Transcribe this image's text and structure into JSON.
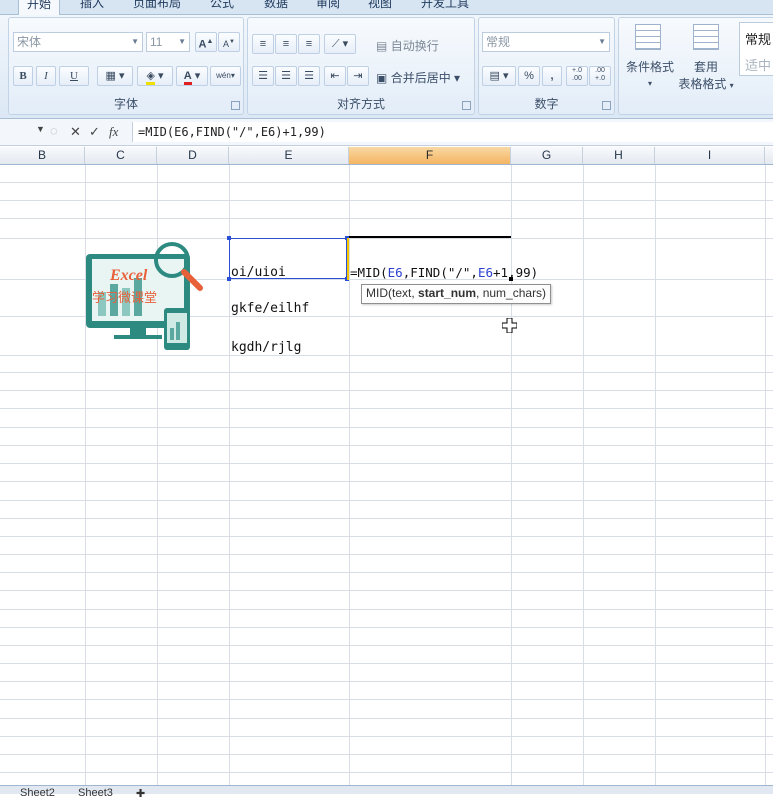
{
  "ribbon": {
    "tabs": [
      "开始",
      "插入",
      "页面布局",
      "公式",
      "数据",
      "审阅",
      "视图",
      "开发工具"
    ],
    "font_group": {
      "label": "字体",
      "font_name": "宋体",
      "font_size": "11",
      "grow_label": "A",
      "shrink_label": "A",
      "bold": "B",
      "italic": "I",
      "underline": "U",
      "font_color_label": "A",
      "phonetic_label": "wén"
    },
    "align_group": {
      "label": "对齐方式",
      "wrap_text": "自动换行",
      "merge_center": "合并后居中"
    },
    "number_group": {
      "label": "数字",
      "format": "常规",
      "percent": "%",
      "comma": ",",
      "inc_decimal": "+.0 .00",
      "dec_decimal": ".00 +.0"
    },
    "styles_group": {
      "conditional_format": "条件格式",
      "table_format_line1": "套用",
      "table_format_line2": "表格格式",
      "cell_style_partial_top": "常规",
      "cell_style_partial_bottom": "适中"
    }
  },
  "formula_bar": {
    "fx": "fx",
    "formula": "=MID(E6,FIND(\"/\",E6)+1,99)"
  },
  "columns": [
    {
      "name": "B",
      "selected": false
    },
    {
      "name": "C",
      "selected": false
    },
    {
      "name": "D",
      "selected": false
    },
    {
      "name": "E",
      "selected": false
    },
    {
      "name": "F",
      "selected": true
    },
    {
      "name": "G",
      "selected": false
    },
    {
      "name": "H",
      "selected": false
    },
    {
      "name": "I",
      "selected": false
    }
  ],
  "cells": {
    "e6": "oi/uioi",
    "e7": "gkfe/eilhf",
    "e8": "kgdh/rjlg"
  },
  "editing": {
    "prefix": "=MID(",
    "ref1": "E6",
    "mid": ",FIND(\"/\",",
    "ref2": "E6",
    "suffix": "+1,99)"
  },
  "tooltip": {
    "func": "MID(text, ",
    "bold_arg": "start_num",
    "rest": ", num_chars)"
  },
  "logo": {
    "word": "Excel",
    "subtitle": "学习微课堂"
  },
  "sheets": [
    "Sheet2",
    "Sheet3"
  ],
  "colors": {
    "selection_border": "#2a4fd7",
    "active_col_header": "#f4b562",
    "logo_teal": "#2d8a80",
    "logo_orange": "#e8603a"
  }
}
